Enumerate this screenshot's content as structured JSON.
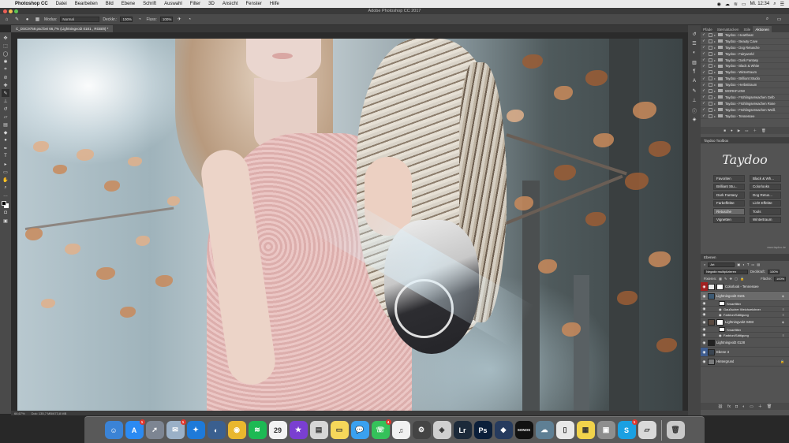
{
  "menubar": {
    "app": "Photoshop CC",
    "items": [
      "Datei",
      "Bearbeiten",
      "Bild",
      "Ebene",
      "Schrift",
      "Auswahl",
      "Filter",
      "3D",
      "Ansicht",
      "Fenster",
      "Hilfe"
    ],
    "clock": "Mi. 12:34"
  },
  "window": {
    "title": "Adobe Photoshop CC 2017"
  },
  "options": {
    "mode_label": "Modus:",
    "mode_value": "Normal",
    "opacity_label": "Deckkr.:",
    "opacity_value": "100%",
    "flow_label": "Fluss:",
    "flow_value": "100%"
  },
  "document": {
    "tab": "C_DSC9759.psd bei 66,7% (Lightningvol2 0181 , RGB/8) *"
  },
  "status": {
    "zoom": "66,67%",
    "doc": "Dok: 135,7 MB/673,8 MB"
  },
  "actions_panel": {
    "tabs": [
      "Pfade",
      "Sternattacken",
      "Stile",
      "Aktionen"
    ],
    "active_tab": "Aktionen",
    "rows": [
      "Taydoo - Heartbeat",
      "Taydoo - Beauty Cave",
      "Taydoo - Dog Retusche",
      "Taydoo - Fairyworld",
      "Taydoo - Dark Fantasy",
      "Taydoo - Black & White",
      "Taydoo - Wintertraum",
      "Taydoo - Brilliant Studio",
      "Taydoo - Herbsttraum",
      "WORKFLOW",
      "Taydoo - Frühlingserwachen Gelb",
      "Taydoo - Frühlingserwachen Rose",
      "Taydoo - Frühlingserwachen Weiß",
      "Taydoo - Tennessee"
    ]
  },
  "toolbox": {
    "title": "Taydoo Toolbox",
    "signature": "Taydoo",
    "buttons": [
      [
        "Favoriten",
        "Black & Wh..."
      ],
      [
        "Brilliant Stu...",
        "Colorlooks"
      ],
      [
        "Dark Fantasy",
        "Dog Retus..."
      ],
      [
        "Farbeffekte",
        "Licht Effekte"
      ],
      [
        "Retusche",
        "Tools"
      ],
      [
        "Vignetten",
        "Wintertraum"
      ]
    ],
    "url": "www.taydoo.de"
  },
  "layers_panel": {
    "title": "Ebenen",
    "filter": "Art",
    "blend": "Negativ multiplizieren",
    "opacity_label": "Deckkraft:",
    "opacity_value": "100%",
    "lock_label": "Fixieren:",
    "fill_label": "Fläche:",
    "fill_value": "100%",
    "rows": [
      {
        "name": "Colorlook - Tennessee",
        "type": "layer",
        "eye": "red"
      },
      {
        "name": "Lightningvol2 0181",
        "type": "layer",
        "selected": true
      },
      {
        "name": "Smartfilter",
        "type": "sub"
      },
      {
        "name": "Gaußscher Weichzeichner",
        "type": "sub"
      },
      {
        "name": "Farbton/Sättigung",
        "type": "sub"
      },
      {
        "name": "Lightningvol2 0493",
        "type": "layer"
      },
      {
        "name": "Smartfilter",
        "type": "sub"
      },
      {
        "name": "Farbton/Sättigung",
        "type": "sub"
      },
      {
        "name": "Lightningvol2 0128",
        "type": "layer"
      },
      {
        "name": "Ebene 3",
        "type": "layer",
        "eye": "blue"
      },
      {
        "name": "Hintergrund",
        "type": "layer"
      }
    ]
  },
  "dock": {
    "apps": [
      {
        "name": "finder-icon",
        "color": "#3b83d6",
        "glyph": "☺"
      },
      {
        "name": "app-store-icon",
        "color": "#2b8af2",
        "glyph": "A",
        "badge": "1"
      },
      {
        "name": "launchpad-icon",
        "color": "#7d8592",
        "glyph": "➚"
      },
      {
        "name": "mail-postage-icon",
        "color": "#9ab0c7",
        "glyph": "✉",
        "badge": "1"
      },
      {
        "name": "safari-icon",
        "color": "#1e7ad9",
        "glyph": "✦"
      },
      {
        "name": "browser-icon",
        "color": "#3a5f8f",
        "glyph": "◐"
      },
      {
        "name": "chrome-icon",
        "color": "#e9b72e",
        "glyph": "◉"
      },
      {
        "name": "spotify-icon",
        "color": "#1db954",
        "glyph": "≋"
      },
      {
        "name": "calendar-icon",
        "color": "#f3f3f3",
        "glyph": "29"
      },
      {
        "name": "imovie-star-icon",
        "color": "#7a3fd1",
        "glyph": "★"
      },
      {
        "name": "preview-icon",
        "color": "#d6d6d6",
        "glyph": "▤"
      },
      {
        "name": "notes-icon",
        "color": "#f6d75a",
        "glyph": "▭"
      },
      {
        "name": "messages-icon",
        "color": "#3aa1f0",
        "glyph": "💬"
      },
      {
        "name": "facetime-icon",
        "color": "#35c25a",
        "glyph": "☏",
        "badge": "4"
      },
      {
        "name": "itunes-icon",
        "color": "#f1f1f1",
        "glyph": "♫"
      },
      {
        "name": "logo-badge-icon",
        "color": "#444444",
        "glyph": "⚙"
      },
      {
        "name": "system-icon",
        "color": "#d0d0d0",
        "glyph": "◈"
      },
      {
        "name": "lightroom-icon",
        "color": "#1c2a3a",
        "glyph": "Lr"
      },
      {
        "name": "photoshop-icon",
        "color": "#0b1f3a",
        "glyph": "Ps"
      },
      {
        "name": "plugin-icon",
        "color": "#263b5e",
        "glyph": "◆"
      },
      {
        "name": "sonos-icon",
        "color": "#111111",
        "glyph": "SONOS"
      },
      {
        "name": "cloud-icon",
        "color": "#5f7f94",
        "glyph": "☁"
      },
      {
        "name": "doc-icon",
        "color": "#e8e8e8",
        "glyph": "▯"
      },
      {
        "name": "stickies-icon",
        "color": "#f2d34b",
        "glyph": "▦"
      },
      {
        "name": "app-icon",
        "color": "#8e8e8e",
        "glyph": "▣"
      },
      {
        "name": "skype-icon",
        "color": "#1ba0e2",
        "glyph": "S",
        "badge": "1"
      },
      {
        "name": "file-icon",
        "color": "#d9d9d9",
        "glyph": "▱"
      },
      {
        "name": "trash-icon",
        "color": "#c9c9c9",
        "glyph": "🗑"
      }
    ]
  }
}
